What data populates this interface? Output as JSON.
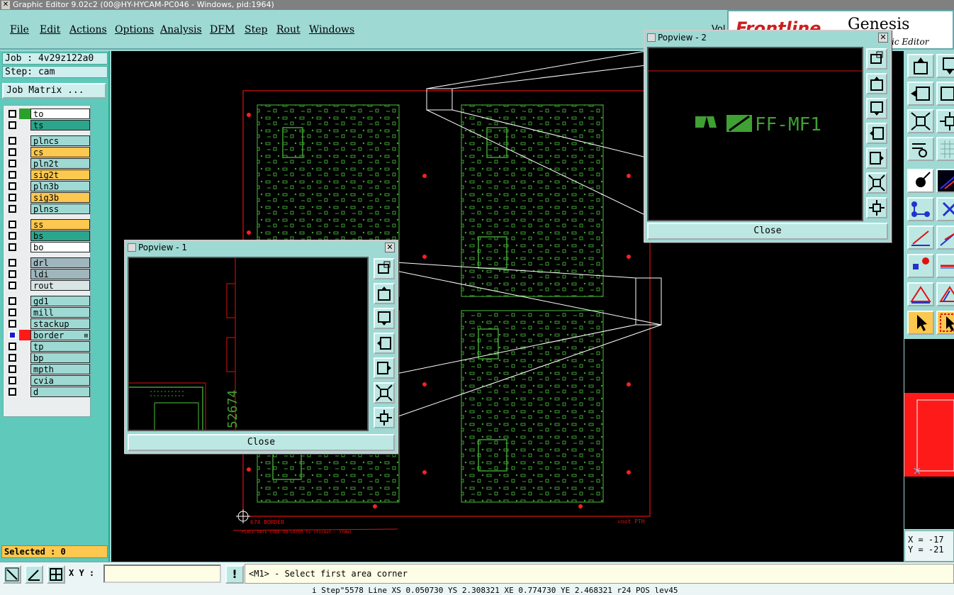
{
  "window": {
    "title": "Graphic Editor 9.02c2 (00@HY-HYCAM-PC046 - Windows, pid:1964)"
  },
  "menu": {
    "file": "File",
    "edit": "Edit",
    "actions": "Actions",
    "options": "Options",
    "analysis": "Analysis",
    "dfm": "DFM",
    "step": "Step",
    "rout": "Rout",
    "windows": "Windows",
    "vol": "Vol"
  },
  "logo": {
    "brand": "Frontline",
    "product": "Genesis 2000",
    "sup": "1",
    "subtitle": "ic Editor"
  },
  "job": {
    "name": "Job : 4v29z122a0",
    "step": "Step: cam",
    "matrix_button": "Job Matrix ..."
  },
  "layers": [
    {
      "name": "to",
      "color": "#ffffff",
      "swatch": "#2aa12a"
    },
    {
      "name": "ts",
      "color": "#2ba68d",
      "swatch": ""
    },
    {
      "name": "plncs",
      "color": "#9fd9d4",
      "swatch": ""
    },
    {
      "name": "cs",
      "color": "#fcc84f",
      "swatch": ""
    },
    {
      "name": "pln2t",
      "color": "#9fd9d4",
      "swatch": ""
    },
    {
      "name": "sig2t",
      "color": "#fcc84f",
      "swatch": ""
    },
    {
      "name": "pln3b",
      "color": "#9fd9d4",
      "swatch": ""
    },
    {
      "name": "sig3b",
      "color": "#fcc84f",
      "swatch": ""
    },
    {
      "name": "plnss",
      "color": "#9fd9d4",
      "swatch": ""
    },
    {
      "name": "ss",
      "color": "#fcc84f",
      "swatch": ""
    },
    {
      "name": "bs",
      "color": "#2ba68d",
      "swatch": ""
    },
    {
      "name": "bo",
      "color": "#ffffff",
      "swatch": ""
    },
    {
      "name": "drl",
      "color": "#9fb6bd",
      "swatch": ""
    },
    {
      "name": "ldi",
      "color": "#9fb6bd",
      "swatch": ""
    },
    {
      "name": "rout",
      "color": "#d9e5e5",
      "swatch": ""
    },
    {
      "name": "gd1",
      "color": "#9fd9d4",
      "swatch": ""
    },
    {
      "name": "mill",
      "color": "#9fd9d4",
      "swatch": ""
    },
    {
      "name": "stackup",
      "color": "#9fd9d4",
      "swatch": ""
    },
    {
      "name": "border",
      "color": "#9fd9d4",
      "swatch": "#ff1a1a",
      "active": true,
      "plus": "⊞"
    },
    {
      "name": "tp",
      "color": "#9fd9d4",
      "swatch": ""
    },
    {
      "name": "bp",
      "color": "#9fd9d4",
      "swatch": ""
    },
    {
      "name": "mpth",
      "color": "#9fd9d4",
      "swatch": ""
    },
    {
      "name": "cvia",
      "color": "#9fd9d4",
      "swatch": ""
    },
    {
      "name": "d",
      "color": "#9fd9d4",
      "swatch": ""
    }
  ],
  "selected": "Selected : 0",
  "popview1": {
    "title": "Popview - 1",
    "close_label": "Close",
    "close_x": "✕",
    "text_vertical": "52674"
  },
  "popview2": {
    "title": "Popview - 2",
    "close_label": "Close",
    "close_x": "✕",
    "text": "FF-MF1"
  },
  "canvas": {
    "border_text": "674  BORDER",
    "not_pth": "=not PTH",
    "place_note": "PLACE DATE CODE ON LAYER ts  (format : YYWW)"
  },
  "coords": {
    "x": "X = -17",
    "y": "Y = -21"
  },
  "bottom": {
    "xy_label": "X Y :",
    "xy_value": "",
    "alert": "!",
    "prompt": "<M1> - Select first area corner",
    "status": "i Step\"5578 Line XS 0.050730 YS 2.308321 XE 0.774730 YE 2.468321 r24 POS lev45"
  },
  "colors": {
    "panel": "#9fd9d4",
    "board_green": "#3fa033",
    "border_red": "#e01010",
    "selected_bg": "#fcc84f"
  }
}
